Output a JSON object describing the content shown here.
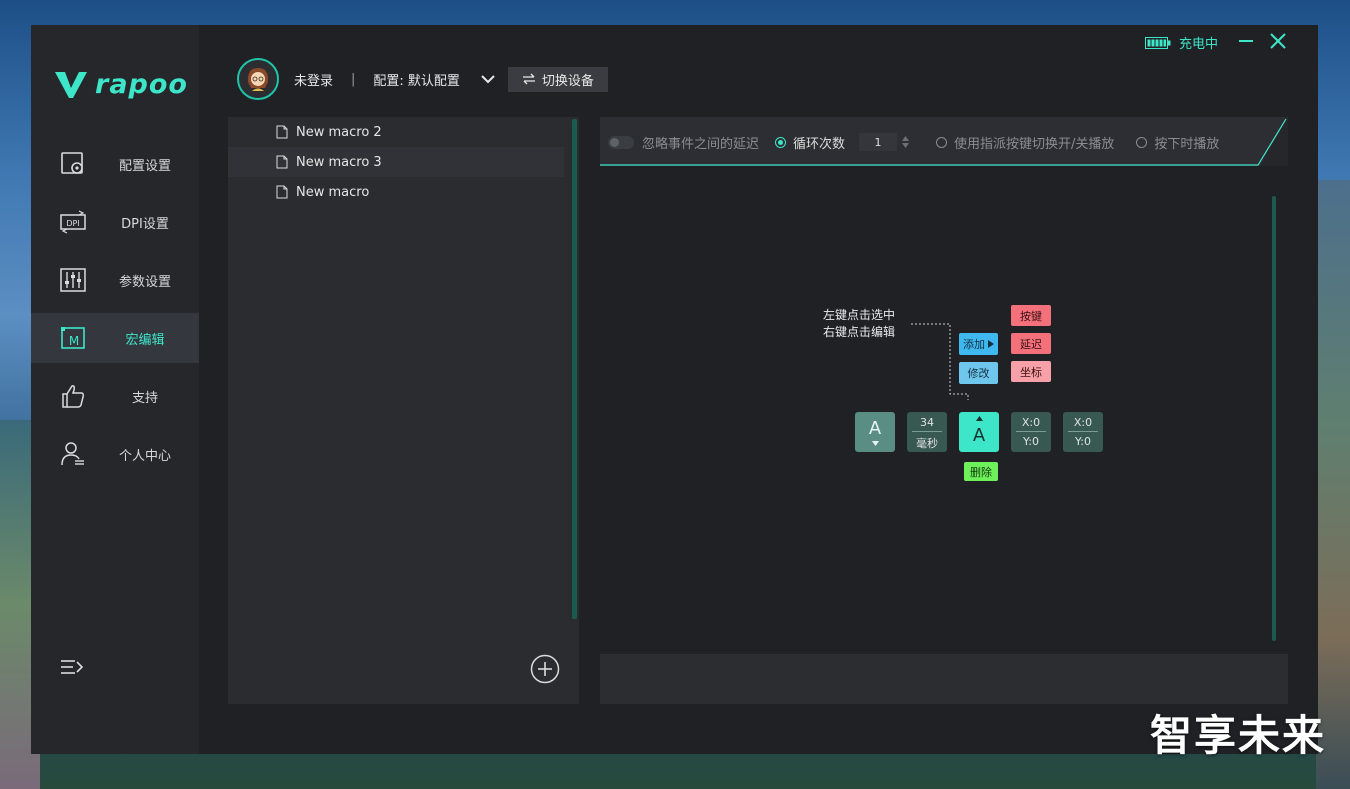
{
  "app": {
    "brand": "rapoo",
    "accent": "#3ee6c9"
  },
  "titlebar": {
    "charging": "充电中"
  },
  "sidebar": {
    "items": [
      {
        "label": "配置设置",
        "icon": "config-icon"
      },
      {
        "label": "DPI设置",
        "icon": "dpi-icon"
      },
      {
        "label": "参数设置",
        "icon": "sliders-icon"
      },
      {
        "label": "宏编辑",
        "icon": "macro-icon",
        "active": true
      },
      {
        "label": "支持",
        "icon": "thumbs-up-icon"
      },
      {
        "label": "个人中心",
        "icon": "user-icon"
      }
    ]
  },
  "header": {
    "login": "未登录",
    "separator": "|",
    "profile": "配置: 默认配置",
    "switch_device": "切换设备"
  },
  "macros": {
    "items": [
      "New macro 2",
      "New macro 3",
      "New macro"
    ]
  },
  "editor": {
    "options": {
      "ignore_delay": "忽略事件之间的延迟",
      "loop_count_label": "循环次数",
      "loop_count": "1",
      "toggle_mode": "使用指派按键切换开/关播放",
      "hold_mode": "按下时播放"
    },
    "hint_line1": "左键点击选中",
    "hint_line2": "右键点击编辑",
    "buttons": {
      "add": "添加",
      "modify": "修改",
      "key": "按键",
      "delay": "延迟",
      "coord": "坐标",
      "delete": "删除"
    },
    "events": [
      {
        "key": "A"
      },
      {
        "delay_value": "34",
        "delay_unit": "毫秒"
      },
      {
        "key": "A"
      },
      {
        "x": "X:0",
        "y": "Y:0"
      },
      {
        "x": "X:0",
        "y": "Y:0"
      }
    ]
  },
  "watermark": "智享未来"
}
